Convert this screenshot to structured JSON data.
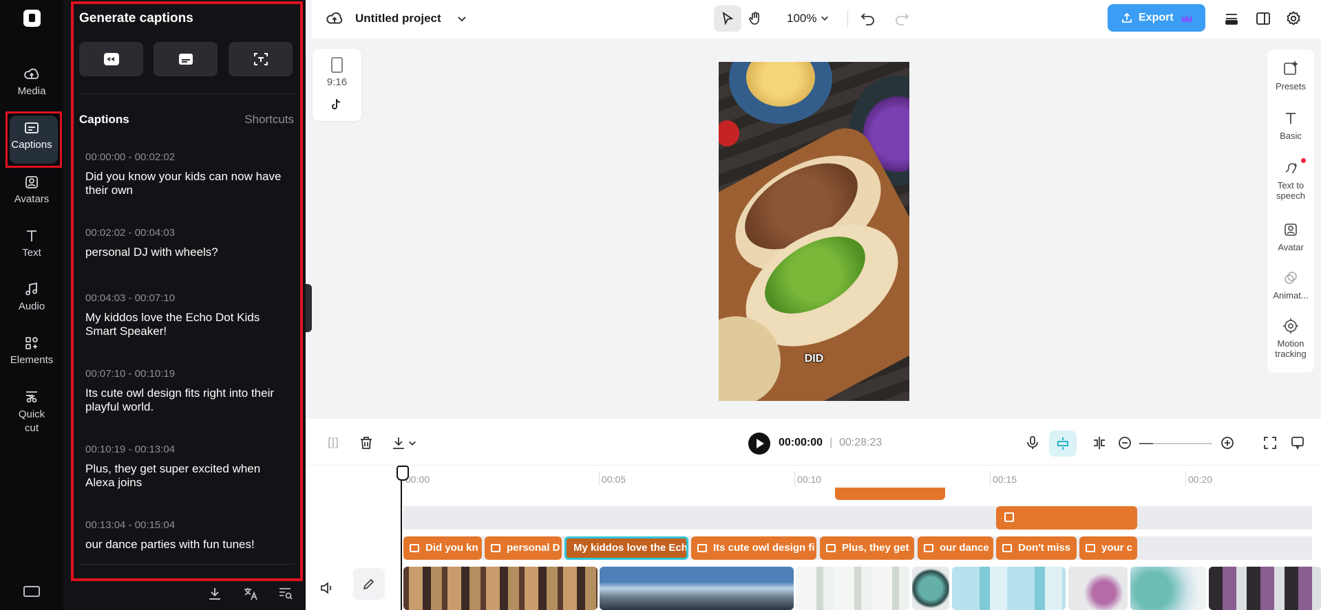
{
  "rail": {
    "items": [
      {
        "label": "Media",
        "icon": "cloud-upload-icon"
      },
      {
        "label": "Captions",
        "icon": "captions-icon",
        "active": true
      },
      {
        "label": "Avatars",
        "icon": "avatar-icon"
      },
      {
        "label": "Text",
        "icon": "text-icon"
      },
      {
        "label": "Audio",
        "icon": "music-note-icon"
      },
      {
        "label": "Elements",
        "icon": "elements-icon"
      },
      {
        "label": "Quick cut",
        "icon": "scissors-icon"
      }
    ]
  },
  "panel": {
    "title": "Generate captions",
    "captions_heading": "Captions",
    "shortcuts_label": "Shortcuts",
    "captions": [
      {
        "time": "00:00:00 - 00:02:02",
        "text": "Did you know your kids can now have their own"
      },
      {
        "time": "00:02:02 - 00:04:03",
        "text": "personal DJ with wheels?"
      },
      {
        "time": "00:04:03 - 00:07:10",
        "text": "My kiddos love the Echo Dot Kids Smart Speaker!"
      },
      {
        "time": "00:07:10 - 00:10:19",
        "text": "Its cute owl design fits right into their playful world."
      },
      {
        "time": "00:10:19 - 00:13:04",
        "text": "Plus, they get super excited when Alexa joins"
      },
      {
        "time": "00:13:04 - 00:15:04",
        "text": "our dance parties with fun tunes!"
      }
    ]
  },
  "topbar": {
    "project_name": "Untitled project",
    "zoom": "100%",
    "export_label": "Export"
  },
  "canvas": {
    "ratio_label": "9:16",
    "subtitle_text": "DID"
  },
  "right_tools": [
    {
      "label": "Presets",
      "icon": "presets-icon"
    },
    {
      "label": "Basic",
      "icon": "text-basic-icon"
    },
    {
      "label": "Text to speech",
      "icon": "text-to-speech-icon"
    },
    {
      "label": "Avatar",
      "icon": "avatar-icon"
    },
    {
      "label": "Animat...",
      "icon": "animation-icon"
    },
    {
      "label": "Motion tracking",
      "icon": "motion-tracking-icon"
    }
  ],
  "timeline": {
    "current_time": "00:00:00",
    "duration": "00:28:23",
    "ruler": [
      "00:00",
      "00:05",
      "00:10",
      "00:15",
      "00:20"
    ],
    "caption_clips": [
      "Did you kn",
      "personal D",
      "My kiddos love the Ech",
      "Its cute owl design fi",
      "Plus, they get",
      "our dance",
      "Don't miss",
      "your c"
    ]
  },
  "colors": {
    "accent": "#3b9df3",
    "clip_orange": "#e4762b",
    "highlight_red": "#e0111f",
    "selection_cyan": "#2ec5d6"
  }
}
